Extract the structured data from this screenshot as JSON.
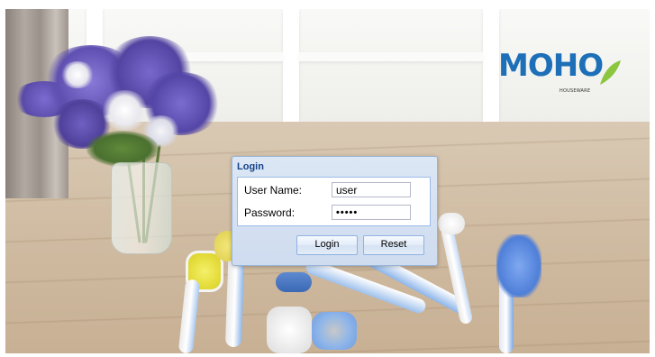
{
  "logo": {
    "brand": "MOHO",
    "tagline": "HOUSEWARE"
  },
  "login": {
    "title": "Login",
    "username_label": "User Name:",
    "username_value": "user",
    "password_label": "Password:",
    "password_value": "•••••",
    "login_button": "Login",
    "reset_button": "Reset"
  },
  "colors": {
    "brand_blue": "#1d6fb8",
    "brand_green": "#8cc63f",
    "dialog_title": "#15428b"
  }
}
